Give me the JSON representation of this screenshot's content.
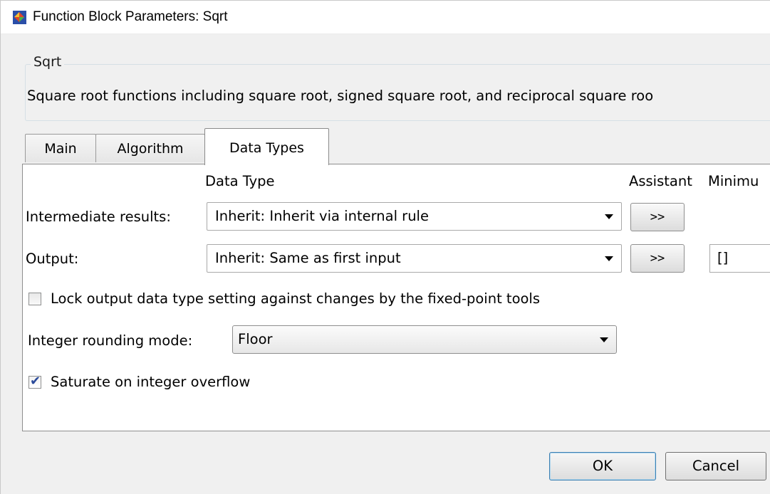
{
  "window": {
    "title": "Function Block Parameters: Sqrt",
    "icon": "simulink-block-icon"
  },
  "block": {
    "group_title": "Sqrt",
    "description": "Square root functions including square root, signed square root, and reciprocal square roo"
  },
  "tabs": [
    {
      "label": "Main",
      "active": false
    },
    {
      "label": "Algorithm",
      "active": false
    },
    {
      "label": "Data Types",
      "active": true
    }
  ],
  "data_types": {
    "col_data_type": "Data Type",
    "col_assistant": "Assistant",
    "col_minimum": "Minimu",
    "intermediate": {
      "label": "Intermediate results:",
      "value": "Inherit: Inherit via internal rule",
      "assistant_label": ">>"
    },
    "output": {
      "label": "Output:",
      "value": "Inherit: Same as first input",
      "assistant_label": ">>",
      "minimum_value": "[]"
    },
    "lock_output": {
      "label": "Lock output data type setting against changes by the fixed-point tools",
      "checked": false
    },
    "rounding": {
      "label": "Integer rounding mode:",
      "value": "Floor"
    },
    "saturate": {
      "label": "Saturate on integer overflow",
      "checked": true
    }
  },
  "footer": {
    "ok_label": "OK",
    "cancel_label": "Cancel"
  },
  "colors": {
    "window_bg": "#f0f0f0",
    "panel_bg": "#ffffff",
    "default_button_border": "#3c7fb1",
    "checkmark": "#2a4a9a"
  }
}
